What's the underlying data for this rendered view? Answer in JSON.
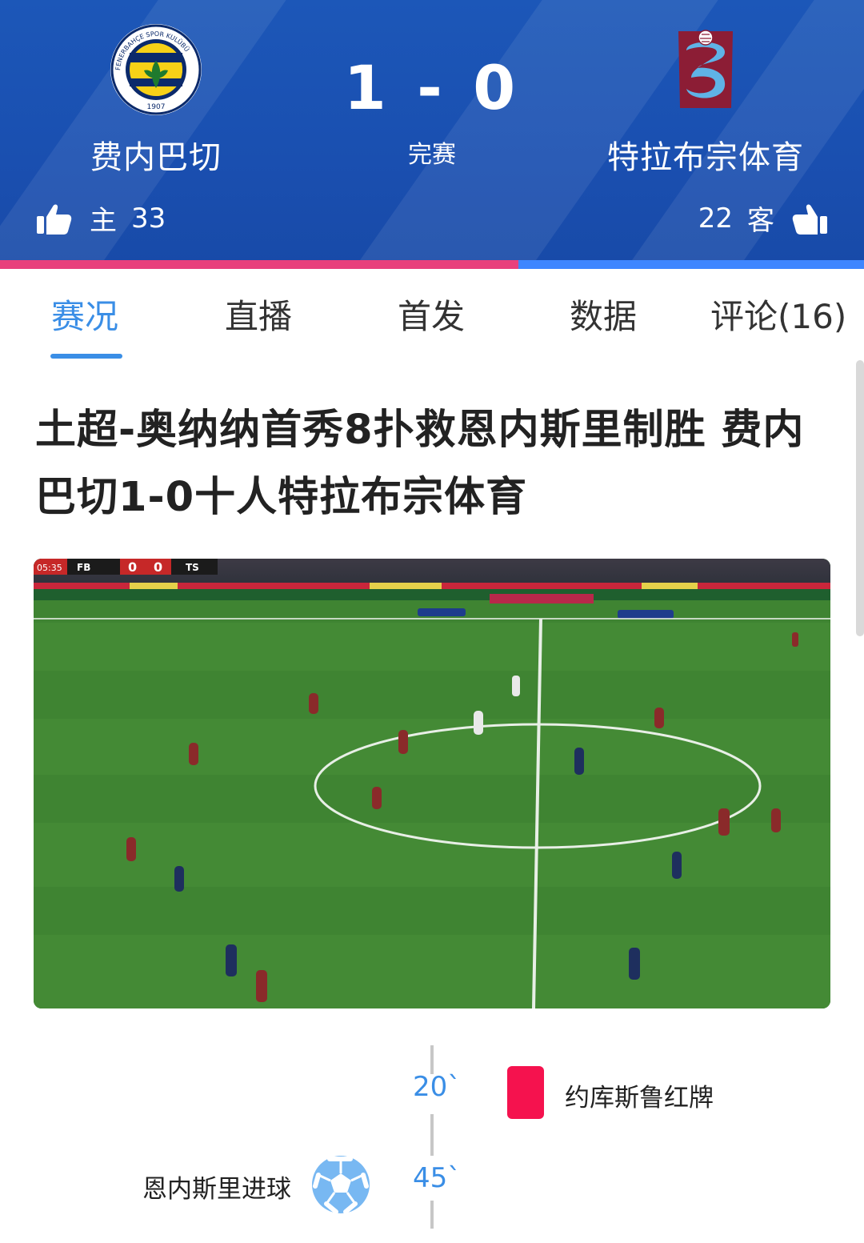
{
  "match": {
    "home": {
      "name": "费内巴切",
      "side_label": "主",
      "votes": "33",
      "logo_text_top": "FENERBAHÇE SPOR KULÜBÜ",
      "logo_year": "1907"
    },
    "away": {
      "name": "特拉布宗体育",
      "side_label": "客",
      "votes": "22"
    },
    "score": "1 - 0",
    "status": "完赛",
    "vote_share_home": 0.6
  },
  "tabs": [
    {
      "label": "赛况",
      "active": true
    },
    {
      "label": "直播",
      "active": false
    },
    {
      "label": "首发",
      "active": false
    },
    {
      "label": "数据",
      "active": false
    },
    {
      "label": "评论(16)",
      "active": false
    }
  ],
  "article": {
    "title": "土超-奥纳纳首秀8扑救恩内斯里制胜 费内巴切1-0十人特拉布宗体育"
  },
  "video": {
    "scorebug": {
      "clock": "05:35",
      "home_abbr": "FB",
      "home_score": "0",
      "away_score": "0",
      "away_abbr": "TS"
    }
  },
  "timeline": [
    {
      "minute": "20`",
      "side": "away",
      "text": "约库斯鲁红牌",
      "icon": "red-card-icon"
    },
    {
      "minute": "45`",
      "side": "home",
      "text": "恩内斯里进球",
      "icon": "soccer-ball-icon"
    }
  ],
  "colors": {
    "header_blue": "#1a4fb0",
    "accent_blue": "#3a8ee6",
    "home_bar": "#e8407c",
    "away_bar": "#3e86ff",
    "red_card": "#f5124e"
  }
}
